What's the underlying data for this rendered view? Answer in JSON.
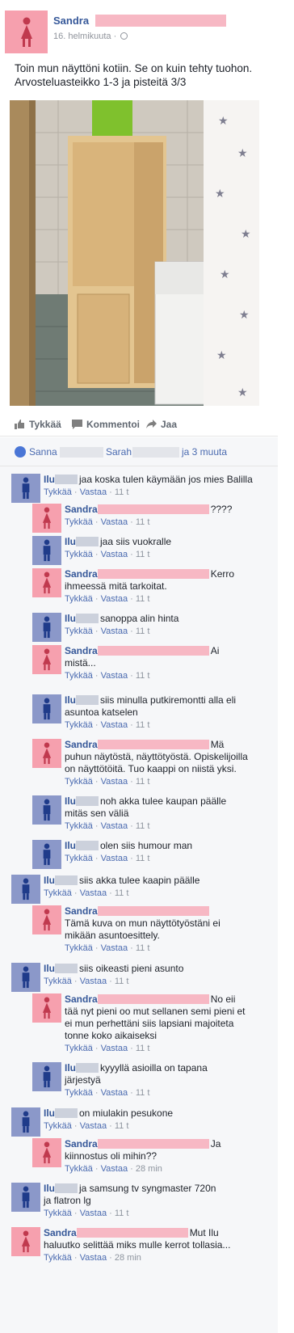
{
  "post": {
    "author": "Sandra",
    "time": "16. helmikuuta",
    "text_line1": "Toin mun näyttöni kotiin. Se on kuin tehty tuohon.",
    "text_line2": "Arvosteluasteikko 1-3 ja pisteitä 3/3",
    "photo_icon": "photo-of-wooden-cabinet-next-to-washing-machine"
  },
  "actions": {
    "like": "Tykkää",
    "comment": "Kommentoi",
    "share": "Jaa"
  },
  "likes": {
    "name1": "Sanna",
    "name2": "Sarah",
    "others": "ja 3 muuta"
  },
  "comment_actions": {
    "like": "Tykkää",
    "reply": "Vastaa"
  },
  "comments": [
    {
      "name": "Ilu",
      "text": "jaa koska tulen käymään jos mies Balilla",
      "text2": "",
      "time": "11 t",
      "gender": "male"
    },
    {
      "name": "Sandra",
      "text": "????",
      "text2": "",
      "time": "11 t",
      "gender": "female"
    },
    {
      "name": "Ilu",
      "text": "jaa siis vuokralle",
      "text2": "",
      "time": "11 t",
      "gender": "male"
    },
    {
      "name": "Sandra",
      "text": "Kerro",
      "text2": "ihmeessä mitä tarkoitat.",
      "time": "11 t",
      "gender": "female"
    },
    {
      "name": "Ilu",
      "text": "sanoppa alin hinta",
      "text2": "",
      "time": "11 t",
      "gender": "male"
    },
    {
      "name": "Sandra",
      "text": "Ai",
      "text2": "mistä...",
      "time": "11 t",
      "gender": "female"
    },
    {
      "name": "Ilu",
      "text": "siis minulla putkiremontti alla eli",
      "text2": "asuntoa katselen",
      "time": "11 t",
      "gender": "male"
    },
    {
      "name": "Sandra",
      "text": "Mä",
      "text2": "puhun näytöstä, näyttötyöstä. Opiskelijoilla",
      "text3": "on näyttötöitä. Tuo kaappi on niistä yksi.",
      "time": "11 t",
      "gender": "female"
    },
    {
      "name": "Ilu",
      "text": "noh akka tulee kaupan päälle",
      "text2": "mitäs sen väliä",
      "time": "11 t",
      "gender": "male"
    },
    {
      "name": "Ilu",
      "text": "olen siis humour man",
      "text2": "",
      "time": "11 t",
      "gender": "male"
    },
    {
      "name": "Ilu",
      "text": "siis akka tulee kaapin päälle",
      "text2": "",
      "time": "11 t",
      "gender": "male"
    },
    {
      "name": "Sandra",
      "text": "",
      "text2": "Tämä kuva on mun näyttötyöstäni ei",
      "text3": "mikään asuntoesittely.",
      "time": "11 t",
      "gender": "female"
    },
    {
      "name": "Ilu",
      "text": "siis oikeasti pieni asunto",
      "text2": "",
      "time": "11 t",
      "gender": "male"
    },
    {
      "name": "Sandra",
      "text": "No eii",
      "text2": "tää nyt pieni oo mut sellanen semi pieni et",
      "text3": "ei mun perhettäni siis lapsiani majoiteta",
      "text4": "tonne koko aikaiseksi",
      "time": "11 t",
      "gender": "female"
    },
    {
      "name": "Ilu",
      "text": "kyyyllä asioilla on tapana",
      "text2": "järjestyä",
      "time": "11 t",
      "gender": "male"
    },
    {
      "name": "Ilu",
      "text": "on miulakin pesukone",
      "text2": "",
      "time": "11 t",
      "gender": "male"
    },
    {
      "name": "Sandra",
      "text": "Ja",
      "text2": "kiinnostus oli mihin??",
      "time": "28 min",
      "gender": "female"
    },
    {
      "name": "Ilu",
      "text": "ja samsung tv syngmaster 720n",
      "text2": "ja flatron lg",
      "time": "11 t",
      "gender": "male"
    },
    {
      "name": "Sandra",
      "text": "Mut Ilu",
      "text2": "haluutko selittää miks mulle kerrot tollasia...",
      "time": "28 min",
      "gender": "female"
    }
  ],
  "colors": {
    "link": "#365899",
    "female_avatar": "#f6a0ae",
    "male_avatar": "#8b98c9",
    "redaction": "#f7b8c4"
  }
}
